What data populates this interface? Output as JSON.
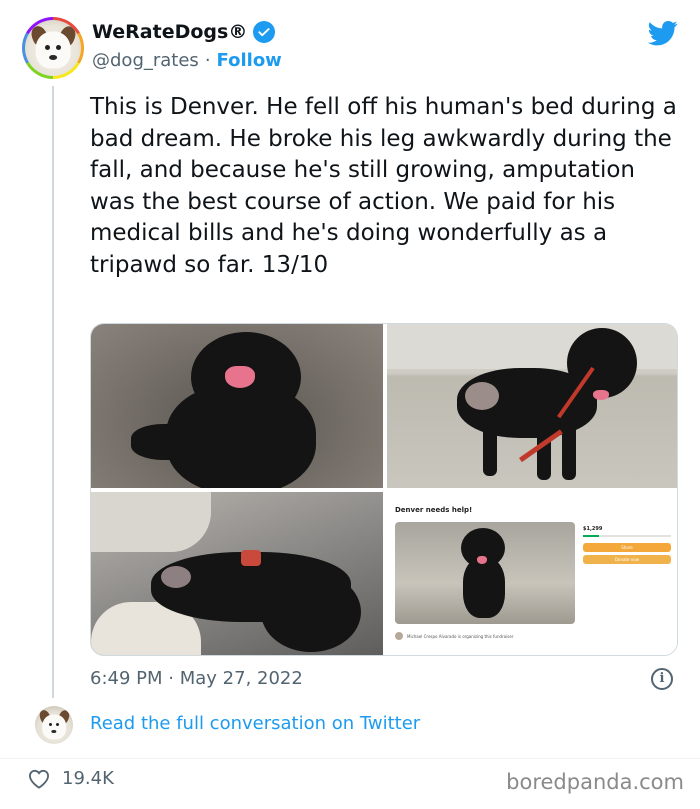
{
  "author": {
    "name": "WeRateDogs®",
    "handle": "@dog_rates",
    "separator": "·",
    "follow_label": "Follow",
    "avatar_icon": "dog-avatar-icon",
    "verified_icon": "verified-badge-icon"
  },
  "tweet": {
    "text": "This is Denver. He fell off his human's bed during a bad dream. He broke his leg awkwardly during the fall, and because he's still growing, amputation was the best course of action. We paid for his medical bills and he's doing wonderfully as a tripawd so far. 13/10",
    "time": "6:49 PM",
    "date": "May 27, 2022",
    "timestamp_separator": "·"
  },
  "media": {
    "fundraiser": {
      "title": "Denver needs help!",
      "amount": "$1,299",
      "donate_share": "Share",
      "donate_now": "Donate now",
      "organizer": "Michael Crespo Alvarado is organizing this fundraiser"
    }
  },
  "conversation_link": "Read the full conversation on Twitter",
  "likes": "19.4K",
  "watermark": "boredpanda.com",
  "colors": {
    "twitter_blue": "#1d9bf0",
    "text_primary": "#0f1419",
    "text_secondary": "#536471"
  }
}
